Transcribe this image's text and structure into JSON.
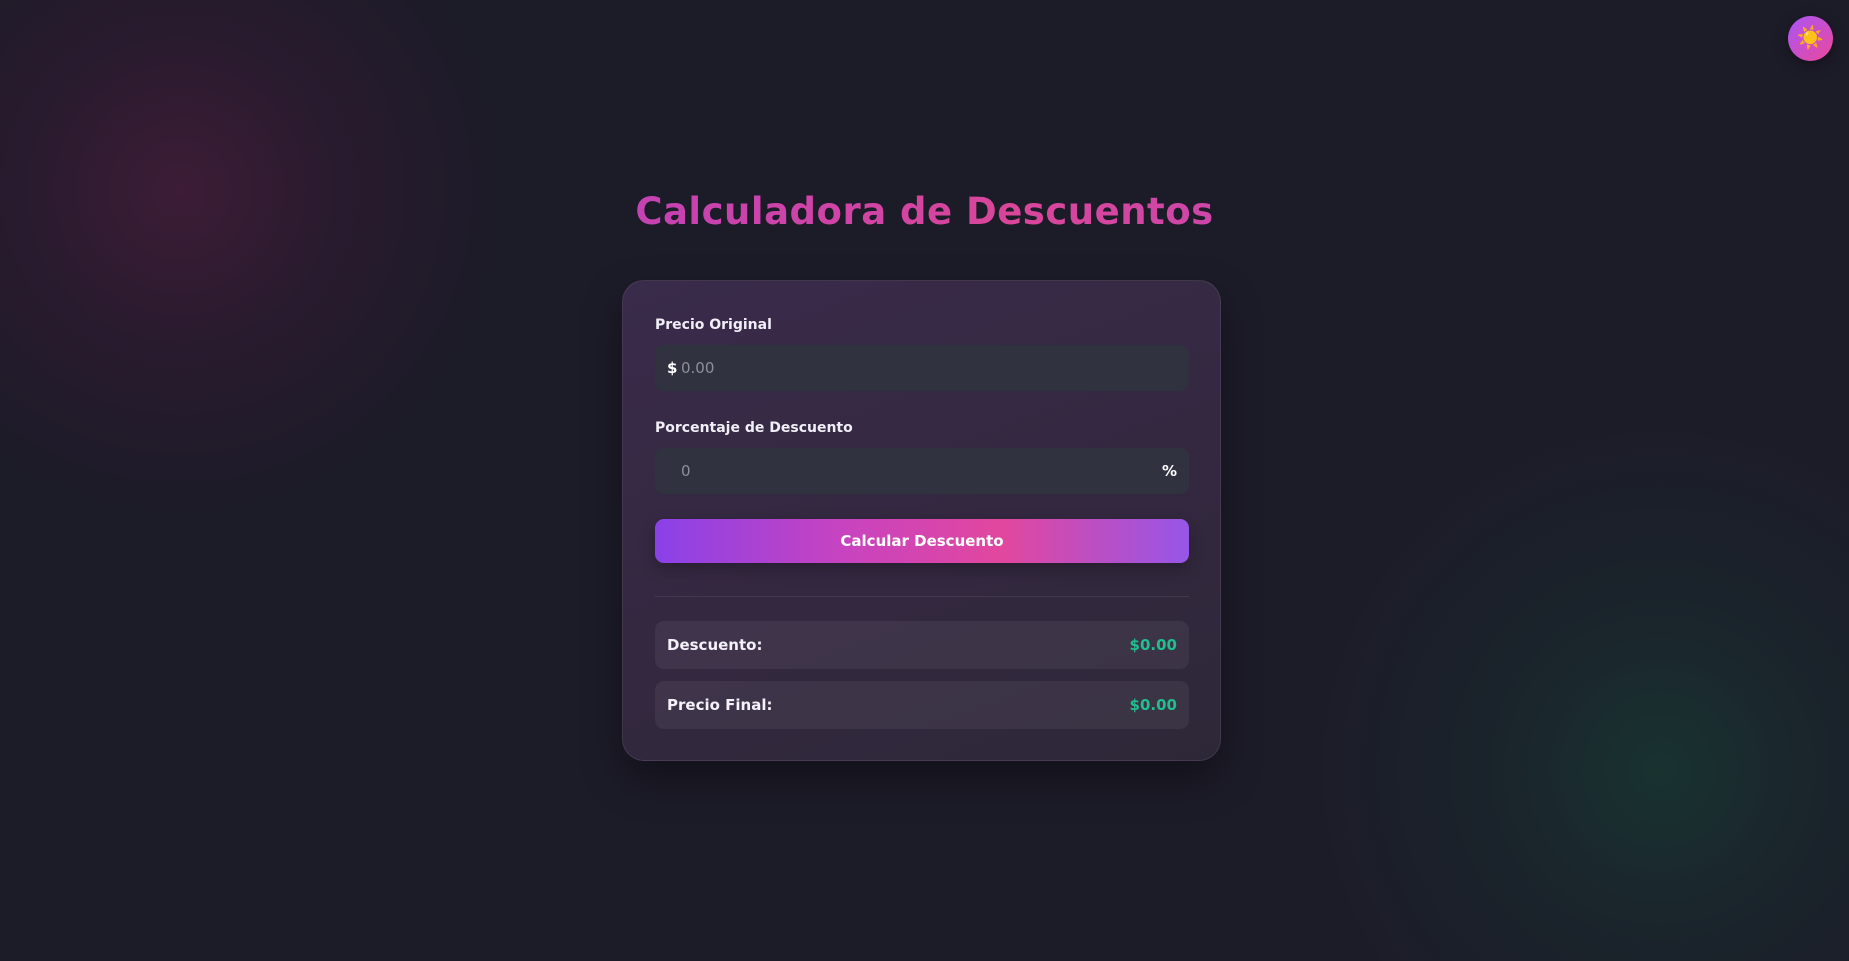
{
  "theme_toggle": {
    "icon": "sun-icon",
    "glyph": "☀️"
  },
  "title": "Calculadora de Descuentos",
  "form": {
    "original_price": {
      "label": "Precio Original",
      "prefix": "$",
      "placeholder": "0.00",
      "value": ""
    },
    "discount_percent": {
      "label": "Porcentaje de Descuento",
      "placeholder": "0",
      "suffix": "%",
      "value": ""
    },
    "calculate_button": "Calcular Descuento"
  },
  "results": {
    "discount": {
      "label": "Descuento:",
      "value": "$0.00"
    },
    "final_price": {
      "label": "Precio Final:",
      "value": "$0.00"
    }
  },
  "colors": {
    "background": "#1c1b28",
    "accent_purple": "#8a41e8",
    "accent_pink": "#e2479e",
    "result_green": "#1fbf8f"
  }
}
